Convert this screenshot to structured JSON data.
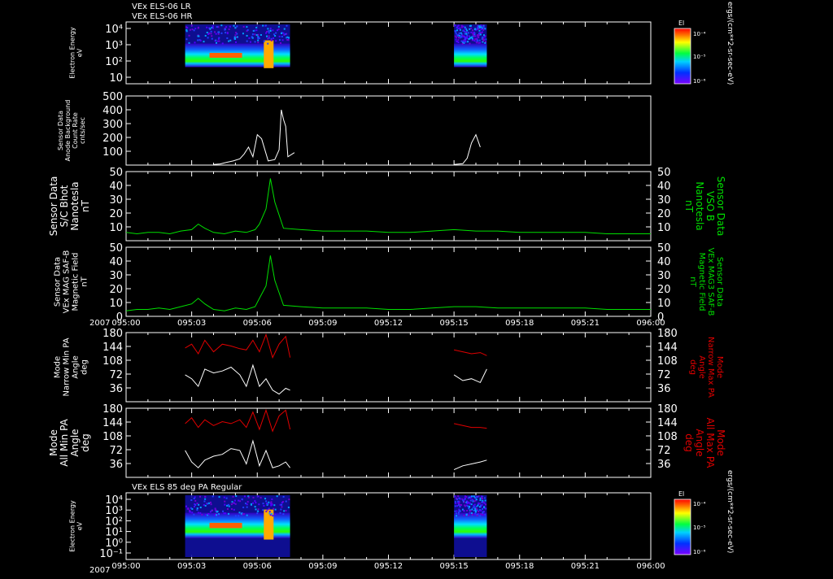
{
  "header": {
    "title_lr": "VEx ELS-06 LR",
    "title_hr": "VEx ELS-06 HR",
    "bottom_title": "VEx ELS 85 deg PA Regular"
  },
  "year_label": "2007",
  "time_ticks": [
    "095:00",
    "095:03",
    "095:06",
    "095:09",
    "095:12",
    "095:15",
    "095:18",
    "095:21",
    "096:00"
  ],
  "colors": {
    "background": "#000000",
    "axis": "#ffffff",
    "green": "#00e000",
    "red": "#e00000",
    "white_trace": "#ffffff"
  },
  "colorbar": {
    "title": "El",
    "units": "ergs/(cm**2-sr-sec-eV)",
    "ticks": [
      "10⁻⁴",
      "10⁻⁵",
      "10⁻⁶"
    ]
  },
  "chart_data": [
    {
      "type": "heatmap",
      "title": "VEx ELS-06 LR / VEx ELS-06 HR",
      "ylabel": [
        "Electron Energy",
        "eV"
      ],
      "yscale": "log",
      "y_ticks": [
        "10⁴",
        "10³",
        "10²",
        "10"
      ],
      "ylim": [
        1,
        20000
      ],
      "coverage_minutes": [
        [
          2.7,
          7.5
        ],
        [
          15.0,
          16.5
        ]
      ],
      "legend": "colorbar-right"
    },
    {
      "type": "line",
      "ylabel": [
        "Sensor Data",
        "Anode Background",
        "Count Rate",
        "cnts/sec"
      ],
      "y_ticks": [
        "500",
        "400",
        "300",
        "200",
        "100"
      ],
      "ylim": [
        0,
        500
      ],
      "series": [
        {
          "color": "white",
          "x": [
            4.0,
            4.3,
            4.6,
            4.9,
            5.2,
            5.4,
            5.6,
            5.8,
            6.0,
            6.2,
            6.5,
            6.8,
            7.0,
            7.1,
            7.2,
            7.3,
            7.4,
            7.7,
            15.0,
            15.4,
            15.6,
            15.8,
            16.0,
            16.2
          ],
          "y": [
            5,
            8,
            20,
            30,
            45,
            80,
            130,
            60,
            220,
            190,
            30,
            40,
            110,
            400,
            330,
            280,
            60,
            90,
            5,
            10,
            50,
            160,
            220,
            130
          ]
        }
      ]
    },
    {
      "type": "line",
      "ylabel": [
        "Sensor Data",
        "S/C Bhot",
        "Nanotesla",
        "nT"
      ],
      "right_label": [
        "Sensor Data",
        "VSO B",
        "Nanotesla",
        "nT"
      ],
      "y_ticks": [
        "50",
        "40",
        "30",
        "20",
        "10"
      ],
      "ylim": [
        0,
        50
      ],
      "series": [
        {
          "color": "green",
          "x": [
            0,
            0.5,
            1,
            1.5,
            2,
            2.5,
            3,
            3.3,
            3.6,
            4,
            4.5,
            5,
            5.5,
            5.9,
            6.1,
            6.4,
            6.6,
            6.8,
            7.2,
            8,
            9,
            10,
            11,
            12,
            13,
            14,
            15,
            16,
            17,
            18,
            19,
            20,
            21,
            22,
            23,
            24
          ],
          "y": [
            6,
            5,
            6,
            6,
            5,
            7,
            8,
            12,
            9,
            6,
            5,
            7,
            6,
            8,
            12,
            23,
            45,
            28,
            9,
            8,
            7,
            7,
            7,
            6,
            6,
            7,
            8,
            7,
            7,
            6,
            6,
            6,
            6,
            5,
            5,
            5
          ]
        }
      ]
    },
    {
      "type": "line",
      "ylabel": [
        "Sensor Data",
        "VEx MAG SAF-B",
        "Magnetic Field",
        "nT"
      ],
      "right_label": [
        "Sensor Data",
        "VEx MAG3 SAF-B",
        "Magnetic Field",
        "nT"
      ],
      "y_ticks": [
        "50",
        "40",
        "30",
        "20",
        "10",
        "0"
      ],
      "ylim": [
        0,
        50
      ],
      "series": [
        {
          "color": "green",
          "x": [
            0,
            0.5,
            1,
            1.5,
            2,
            2.5,
            3,
            3.3,
            3.6,
            4,
            4.5,
            5,
            5.5,
            5.9,
            6.1,
            6.4,
            6.6,
            6.8,
            7.2,
            8,
            9,
            10,
            11,
            12,
            13,
            14,
            15,
            16,
            17,
            18,
            19,
            20,
            21,
            22,
            23,
            24
          ],
          "y": [
            4,
            5,
            5,
            6,
            5,
            7,
            9,
            13,
            9,
            5,
            4,
            6,
            5,
            7,
            13,
            22,
            44,
            26,
            8,
            7,
            6,
            6,
            6,
            5,
            5,
            6,
            7,
            7,
            6,
            6,
            6,
            6,
            6,
            5,
            5,
            5
          ]
        }
      ]
    },
    {
      "type": "line",
      "ylabel": [
        "Mode",
        "Narrow Min PA",
        "Angle",
        "deg"
      ],
      "right_label": [
        "Mode",
        "Narrow Max PA",
        "Angle",
        "deg"
      ],
      "y_ticks": [
        "180",
        "144",
        "108",
        "72",
        "36"
      ],
      "ylim": [
        0,
        180
      ],
      "series": [
        {
          "color": "red",
          "x": [
            2.7,
            3.0,
            3.3,
            3.6,
            4.0,
            4.4,
            4.8,
            5.2,
            5.5,
            5.8,
            6.1,
            6.4,
            6.7,
            7.0,
            7.3,
            7.5,
            15.0,
            15.4,
            15.8,
            16.2,
            16.5
          ],
          "y": [
            140,
            150,
            125,
            160,
            130,
            150,
            145,
            138,
            135,
            160,
            130,
            175,
            115,
            150,
            170,
            115,
            135,
            130,
            125,
            128,
            120
          ]
        },
        {
          "color": "white",
          "x": [
            2.7,
            3.0,
            3.3,
            3.6,
            4.0,
            4.4,
            4.8,
            5.2,
            5.5,
            5.8,
            6.1,
            6.4,
            6.7,
            7.0,
            7.3,
            7.5,
            15.0,
            15.4,
            15.8,
            16.2,
            16.5
          ],
          "y": [
            70,
            60,
            40,
            85,
            75,
            80,
            90,
            70,
            40,
            95,
            40,
            60,
            30,
            20,
            35,
            30,
            70,
            55,
            60,
            50,
            85
          ]
        }
      ]
    },
    {
      "type": "line",
      "ylabel": [
        "Mode",
        "All Min PA",
        "Angle",
        "deg"
      ],
      "right_label": [
        "Mode",
        "All Max PA",
        "Angle",
        "deg"
      ],
      "y_ticks": [
        "180",
        "144",
        "108",
        "72",
        "36"
      ],
      "ylim": [
        0,
        180
      ],
      "series": [
        {
          "color": "red",
          "x": [
            2.7,
            3.0,
            3.3,
            3.6,
            4.0,
            4.4,
            4.8,
            5.2,
            5.5,
            5.8,
            6.1,
            6.4,
            6.7,
            7.0,
            7.3,
            7.5,
            15.0,
            15.4,
            15.8,
            16.2,
            16.5
          ],
          "y": [
            140,
            155,
            130,
            150,
            135,
            145,
            140,
            150,
            130,
            170,
            125,
            175,
            120,
            160,
            175,
            125,
            140,
            135,
            130,
            130,
            128
          ]
        },
        {
          "color": "white",
          "x": [
            2.7,
            3.0,
            3.3,
            3.6,
            4.0,
            4.4,
            4.8,
            5.2,
            5.5,
            5.8,
            6.1,
            6.4,
            6.7,
            7.0,
            7.3,
            7.5,
            15.0,
            15.4,
            15.8,
            16.2,
            16.5
          ],
          "y": [
            70,
            40,
            25,
            45,
            55,
            60,
            75,
            70,
            35,
            95,
            30,
            70,
            25,
            30,
            40,
            25,
            20,
            30,
            35,
            40,
            45
          ]
        }
      ]
    },
    {
      "type": "heatmap",
      "title": "VEx ELS 85 deg PA Regular",
      "ylabel": [
        "Electron Energy",
        "eV"
      ],
      "yscale": "log",
      "y_ticks": [
        "10⁴",
        "10³",
        "10²",
        "10¹",
        "10⁰",
        "10⁻¹"
      ],
      "ylim": [
        0.1,
        20000
      ],
      "coverage_minutes": [
        [
          2.7,
          7.5
        ],
        [
          15.0,
          16.5
        ]
      ],
      "legend": "colorbar-right"
    }
  ]
}
